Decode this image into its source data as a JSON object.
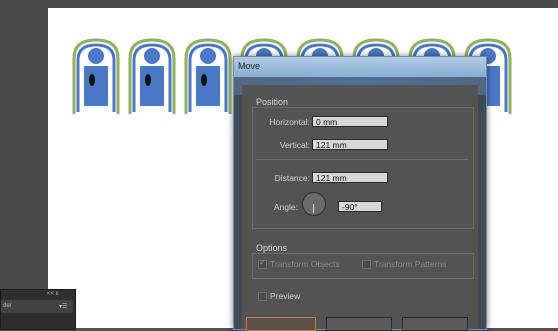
{
  "dialog": {
    "title": "Move",
    "position_group_label": "Position",
    "horizontal_label": "Horizontal:",
    "horizontal_value": "0 mm",
    "vertical_label": "Vertical:",
    "vertical_value": "121 mm",
    "distance_label": "Distance:",
    "distance_value": "121 mm",
    "angle_label": "Angle:",
    "angle_value": "-90°",
    "options_group_label": "Options",
    "transform_objects_label": "Transform Objects",
    "transform_patterns_label": "Transform Patterns",
    "preview_label": "Preview"
  },
  "panel": {
    "tab_label": "der",
    "controls": "<< x",
    "menu_glyph": "▾☰"
  },
  "colors": {
    "ornament_blue": "#4a78c8",
    "ornament_green": "#8fb35a",
    "dialog_title": "#9cc2e6",
    "primary_button_border": "#c0784a"
  },
  "icons": [
    "ornament-icon",
    "angle-dial-icon",
    "checkmark-icon",
    "panel-menu-icon"
  ]
}
